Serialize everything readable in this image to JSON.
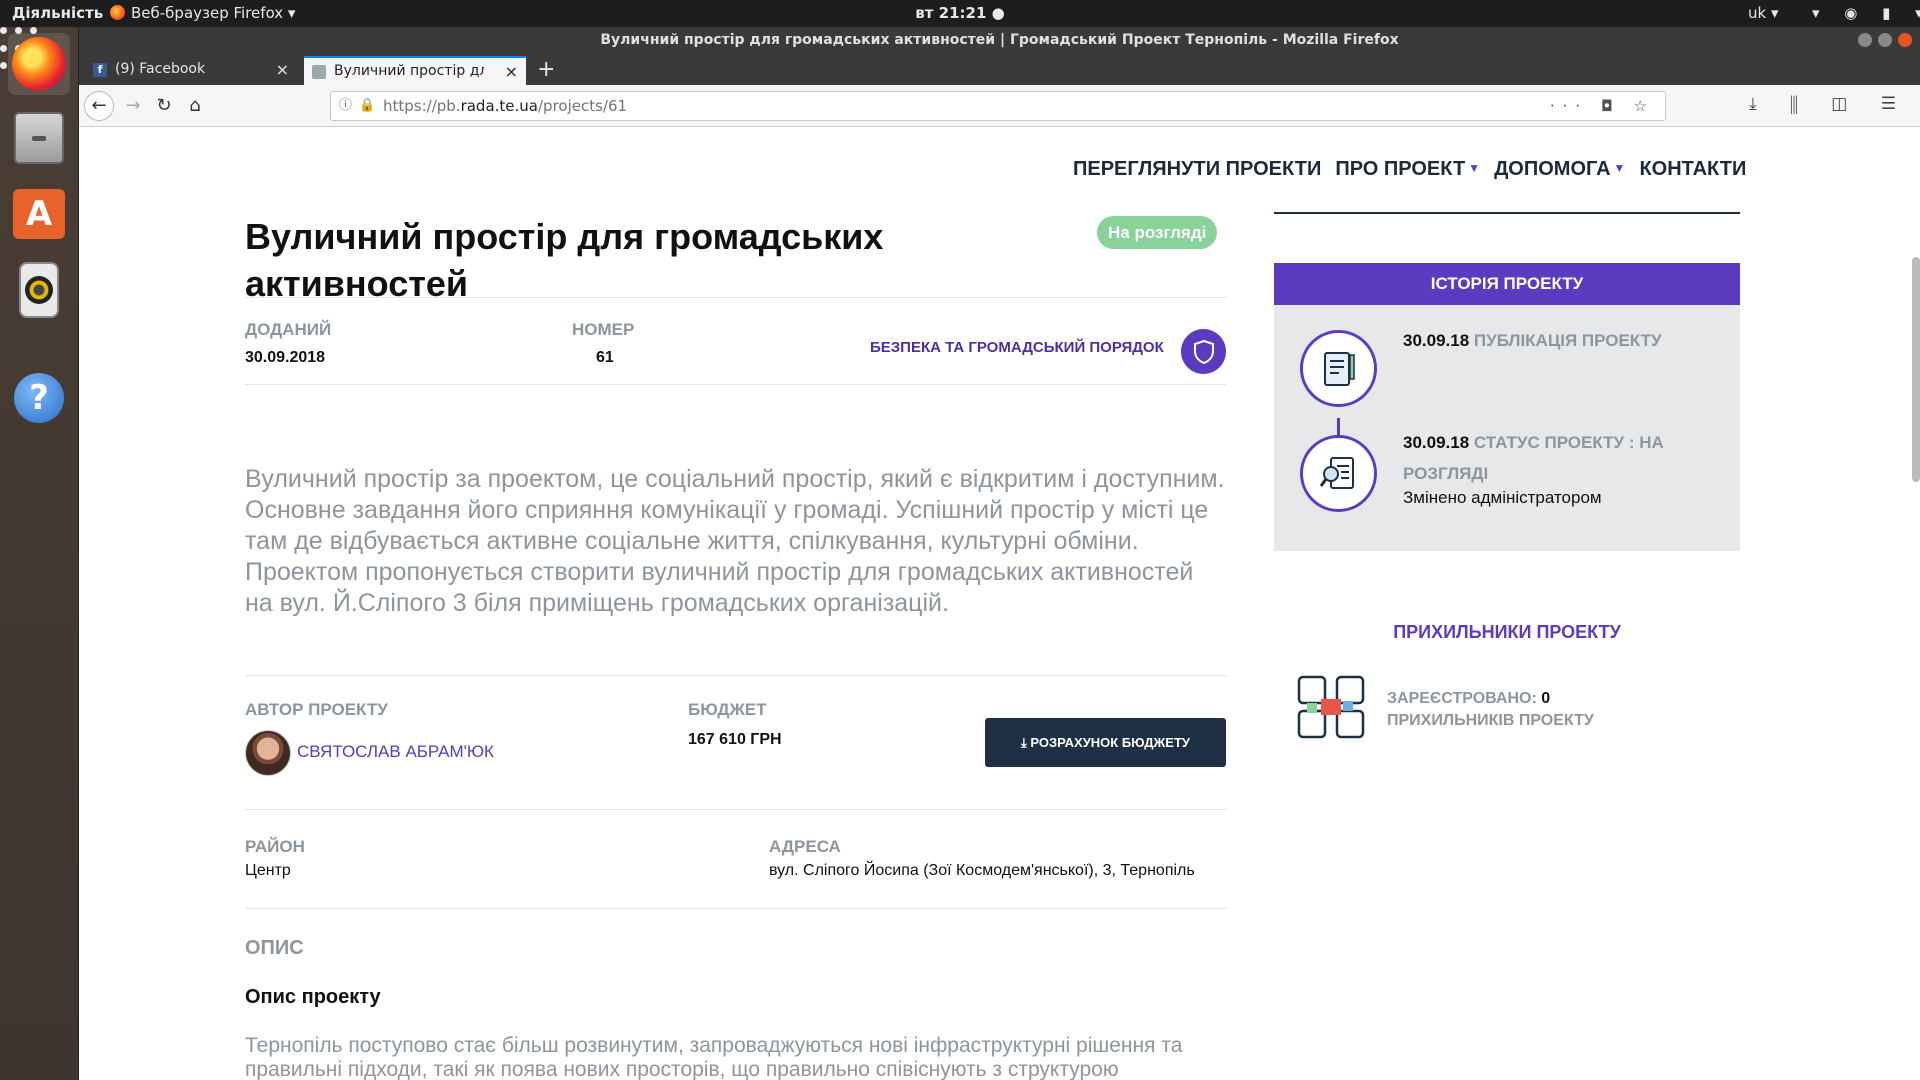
{
  "topbar": {
    "activities": "Діяльність",
    "app_menu": "Веб-браузер Firefox ▾",
    "clock": "вт 21:21 ●",
    "lang": "uk ▾",
    "sys_icons": "▾ ◉ ▮ ▾"
  },
  "window": {
    "title": "Вуличний простір для громадських активностей | Громадський Проект Тернопіль - Mozilla Firefox"
  },
  "tabs": [
    {
      "title": "(9) Facebook",
      "close": "×"
    },
    {
      "title": "Вуличний простір для г",
      "close": "×"
    }
  ],
  "new_tab": "+",
  "navbar": {
    "back": "←",
    "forward": "→",
    "reload": "↻",
    "home": "⌂",
    "url_info": "ⓘ",
    "url_lock": "🔒",
    "url_prefix": "https://pb.",
    "url_domain": "rada.te.ua",
    "url_path": "/projects/61",
    "url_actions": "··· ◘ ☆",
    "toolbar_right": "⤓ ⫼ ◫ ☰"
  },
  "site_nav": [
    {
      "label": "ПЕРЕГЛЯНУТИ ПРОЕКТИ",
      "caret": ""
    },
    {
      "label": "ПРО ПРОЕКТ",
      "caret": "▼"
    },
    {
      "label": "ДОПОМОГА",
      "caret": "▼"
    },
    {
      "label": "КОНТАКТИ",
      "caret": ""
    }
  ],
  "project": {
    "title": "Вуличний простір для громадських активностей",
    "status": "На розгляді",
    "added_label": "ДОДАНИЙ",
    "added_value": "30.09.2018",
    "number_label": "НОМЕР",
    "number_value": "61",
    "category": "БЕЗПЕКА ТА ГРОМАДСЬКИЙ ПОРЯДОК",
    "summary": "Вуличний простір за проектом, це соціальний простір, який є відкритим і доступним. Основне завдання його сприяння комунікації у громаді. Успішний простір у місті це там де відбувається активне соціальне життя, спілкування, культурні обміни. Проектом пропонується створити вуличний простір для громадських активностей на вул. Й.Сліпого 3 біля приміщень громадських організацій.",
    "author_label": "АВТОР ПРОЕКТУ",
    "author_name": "СВЯТОСЛАВ АБРАМ'ЮК",
    "budget_label": "БЮДЖЕТ",
    "budget_value": "167 610 ГРН",
    "budget_button": "⤓ РОЗРАХУНОК БЮДЖЕТУ",
    "district_label": "РАЙОН",
    "district_value": "Центр",
    "address_label": "АДРЕСА",
    "address_value": "вул. Сліпого Йосипа (Зої Космодем'янської), 3, Тернопіль",
    "section_heading": "ОПИС",
    "sub_heading": "Опис проекту",
    "description": "Тернопіль поступово стає більш розвинутим, запроваджуються нові інфраструктурні рішення та правильні підходи, такі як поява нових просторів, що правильно співіснують з структурою"
  },
  "sidebar": {
    "history_title": "ІСТОРІЯ ПРОЕКТУ",
    "history": [
      {
        "date": "30.09.18",
        "text": "ПУБЛІКАЦІЯ ПРОЕКТУ",
        "note": ""
      },
      {
        "date": "30.09.18",
        "text": "СТАТУС ПРОЕКТУ : НА РОЗГЛЯДІ",
        "note": "Змінено адміністратором"
      }
    ],
    "supporters_title": "ПРИХИЛЬНИКИ ПРОЕКТУ",
    "supporters_label": "ЗАРЕЄСТРОВАНО:",
    "supporters_count": "0",
    "supporters_suffix": "ПРИХИЛЬНИКІВ ПРОЕКТУ"
  },
  "colors": {
    "accent": "#5b3bbf",
    "status": "#8ad29a",
    "button": "#1f3044",
    "muted_text": "#8d959e"
  }
}
